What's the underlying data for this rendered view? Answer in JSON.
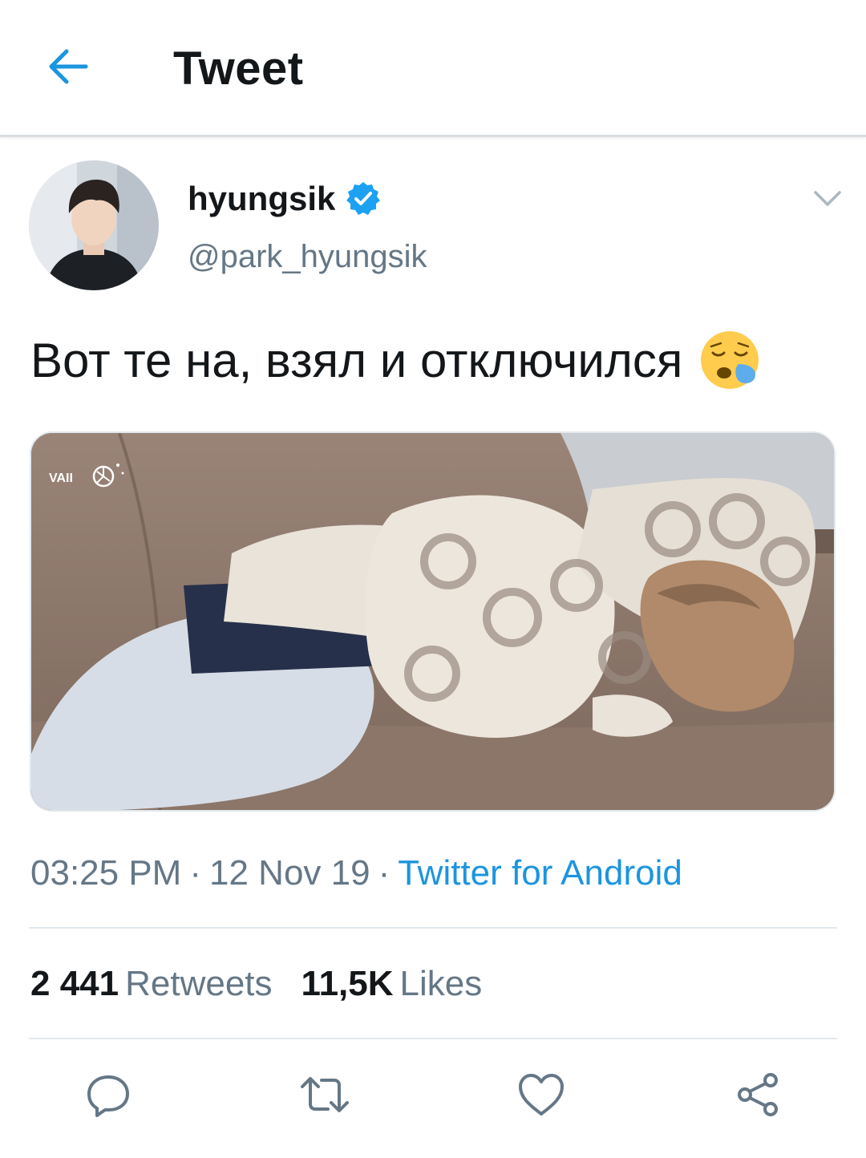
{
  "header": {
    "title": "Tweet",
    "back_icon": "arrow-left-icon"
  },
  "author": {
    "display_name": "hyungsik",
    "handle": "@park_hyungsik",
    "verified": true
  },
  "tweet": {
    "text": "Вот те на, взял и отключился",
    "emoji": "sleepy-face-emoji",
    "media_watermark": "VAII"
  },
  "meta": {
    "time": "03:25 PM",
    "separator": "·",
    "date": "12 Nov 19",
    "source": "Twitter for Android"
  },
  "stats": {
    "retweets_count": "2 441",
    "retweets_label": "Retweets",
    "likes_count": "11,5K",
    "likes_label": "Likes"
  },
  "actions": [
    "reply-icon",
    "retweet-icon",
    "like-icon",
    "share-icon"
  ],
  "colors": {
    "accent": "#1b95e0",
    "text_primary": "#14171a",
    "text_secondary": "#657786",
    "divider": "#e1e8ed"
  }
}
